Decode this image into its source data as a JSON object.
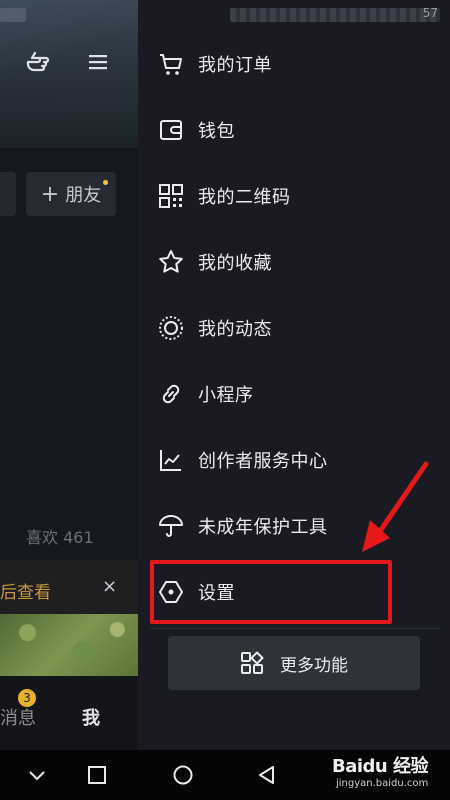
{
  "status_bar": {
    "time_partial": "57"
  },
  "left_pane": {
    "add_friend_label": "朋友",
    "likes_text": "喜欢 461",
    "promo_text": "后查看",
    "close_glyph": "×",
    "tabs": {
      "messages_partial": "消息",
      "messages_badge": "3",
      "me": "我"
    }
  },
  "drawer": {
    "items": [
      {
        "label": "我的订单",
        "icon": "cart-icon"
      },
      {
        "label": "钱包",
        "icon": "wallet-icon"
      },
      {
        "label": "我的二维码",
        "icon": "qr-code-icon"
      },
      {
        "label": "我的收藏",
        "icon": "star-icon"
      },
      {
        "label": "我的动态",
        "icon": "moments-icon"
      },
      {
        "label": "小程序",
        "icon": "link-icon"
      },
      {
        "label": "创作者服务中心",
        "icon": "chart-icon"
      },
      {
        "label": "未成年保护工具",
        "icon": "umbrella-icon"
      },
      {
        "label": "设置",
        "icon": "settings-hexagon-icon"
      }
    ],
    "more_button": "更多功能"
  },
  "annotation": {
    "highlight_color": "#e3191b"
  },
  "watermark": {
    "main": "Baidu 经验",
    "sub": "jingyan.baidu.com"
  },
  "colors": {
    "accent_gold": "#c59a3a",
    "badge_yellow": "#e6b42b",
    "drawer_bg": "#1a1b22"
  }
}
